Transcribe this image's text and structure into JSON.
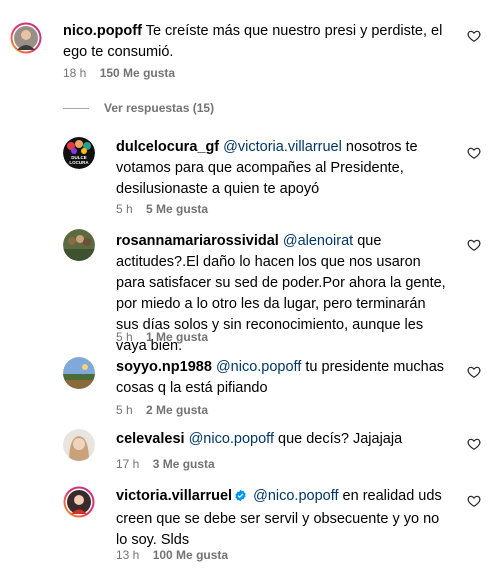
{
  "comments": [
    {
      "user": "nico.popoff",
      "text": "Te creíste más que nuestro presi y perdiste, el ego te consumió.",
      "time": "18 h",
      "likes": "150 Me gusta"
    },
    {
      "user": "dulcelocura_gf",
      "mention": "@victoria.villarruel",
      "text": "nosotros te votamos para que acompañes al Presidente, desilusionaste a quien te apoyó",
      "time": "5 h",
      "likes": "5 Me gusta",
      "avatar_text": "DULCE LOCURA"
    },
    {
      "user": "rosannamariarossividal",
      "mention": "@alenoirat",
      "text": "que actitudes?.El daño lo hacen los que nos usaron para satisfacer su sed de poder.Por ahora la gente, por miedo a lo otro les da lugar, pero terminarán sus días solos y sin reconocimiento, aunque les vaya bien.",
      "time": "5 h",
      "likes": "1 Me gusta"
    },
    {
      "user": "soyyo.np1988",
      "mention": "@nico.popoff",
      "text": "tu presidente muchas cosas q la está pifiando",
      "time": "5 h",
      "likes": "2 Me gusta"
    },
    {
      "user": "celevalesi",
      "mention": "@nico.popoff",
      "text": "que decís? Jajajaja",
      "time": "17 h",
      "likes": "3 Me gusta"
    },
    {
      "user": "victoria.villarruel",
      "mention": "@nico.popoff",
      "text": "en realidad uds creen que se debe ser servil y obsecuente y yo no lo soy. Slds",
      "time": "13 h",
      "likes": "100 Me gusta",
      "verified": true
    }
  ],
  "view_replies": "Ver respuestas (15)",
  "colors": {
    "mention": "#00376b",
    "meta": "#737373",
    "verified": "#0095f6"
  },
  "icons": [
    "heart-icon",
    "verified-badge-icon"
  ]
}
